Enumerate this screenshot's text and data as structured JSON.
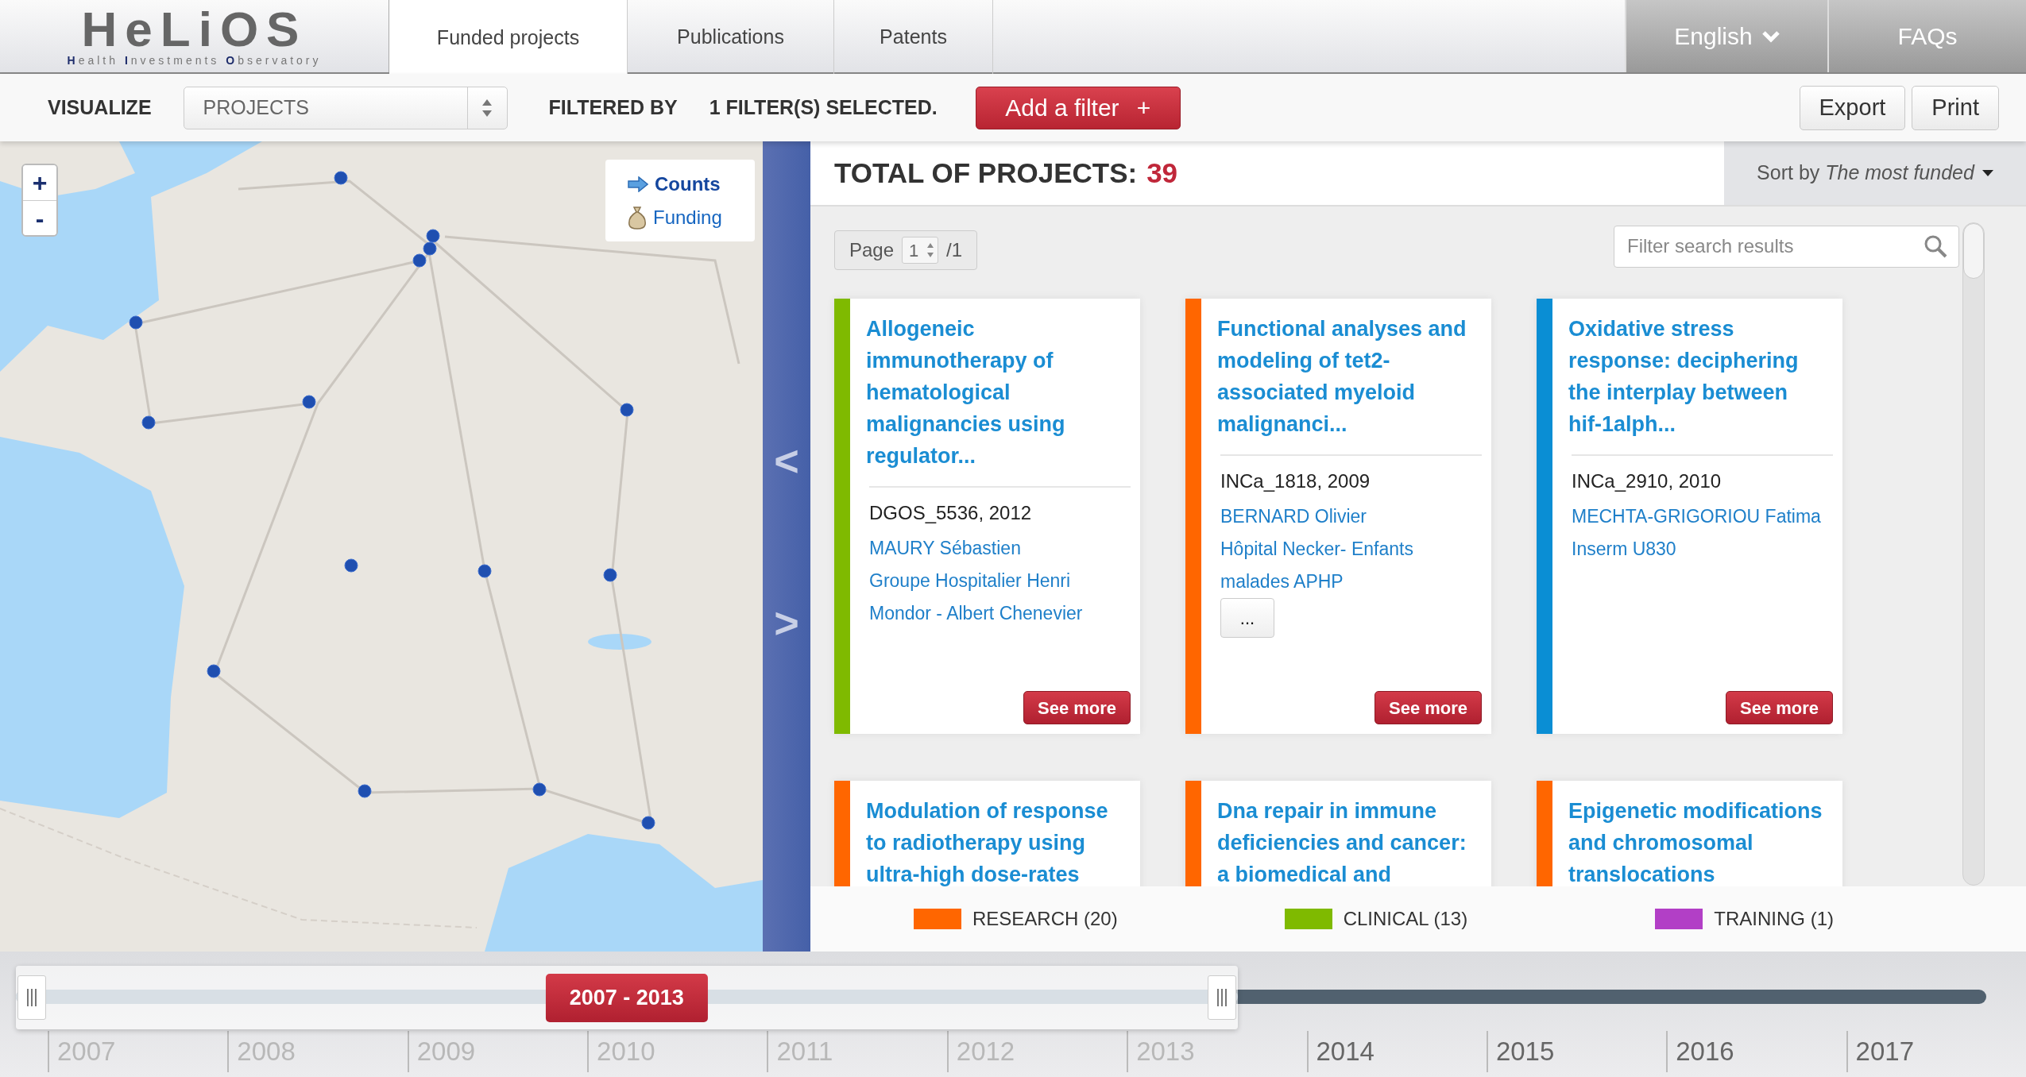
{
  "header": {
    "logo": {
      "title": "HeLiOS",
      "subtitle": "**H**ealth **I**nvestments **O**bservatory"
    },
    "tabs": [
      {
        "label": "Funded projects",
        "selected": true
      },
      {
        "label": "Publications",
        "selected": false
      },
      {
        "label": "Patents",
        "selected": false
      }
    ],
    "language": "English",
    "faqs": "FAQs"
  },
  "toolbar": {
    "visualize_label": "VISUALIZE",
    "visualize_value": "PROJECTS",
    "filtered_label": "FILTERED BY",
    "filter_status": "1 FILTER(S) SELECTED.",
    "add_filter": "Add a filter",
    "add_icon": "+",
    "buttons": [
      "Export",
      "Print"
    ]
  },
  "map": {
    "zoom_in": "+",
    "zoom_out": "-",
    "layers": [
      {
        "label": "Counts",
        "selected": true
      },
      {
        "label": "Funding",
        "selected": false
      }
    ],
    "collapse": "<",
    "expand": ">"
  },
  "results": {
    "total_label": "TOTAL OF PROJECTS:",
    "total": "39",
    "sort": "Sort by *The most funded*",
    "page_label": "Page",
    "page_value": "1",
    "page_total": "/1",
    "search_placeholder": "Filter search results",
    "cards": [
      {
        "color": "#7fba00",
        "title": "Allogeneic\nimmunotherapy of\nhematological\nmalignancies using\nregulator...",
        "code": "DGOS_5536, 2012",
        "people": [
          "MAURY Sébastien",
          "Groupe Hospitalier Henri\nMondor - Albert Chenevier"
        ],
        "button": "See more"
      },
      {
        "color": "#ff6600",
        "title": "Functional analyses and\nmodeling of tet2-\nassociated myeloid\nmalignanci...",
        "code": "INCa_1818, 2009",
        "people": [
          "BERNARD Olivier",
          "Hôpital Necker- Enfants\nmalades APHP"
        ],
        "more": "...",
        "button": "See more"
      },
      {
        "color": "#0a8ed4",
        "title": "Oxidative stress\nresponse: deciphering\nthe interplay between\nhif-1alph...",
        "code": "INCa_2910, 2010",
        "people": [
          "MECHTA-GRIGORIOU Fatima",
          "Inserm U830"
        ],
        "button": "See more"
      },
      {
        "color": "#ff6600",
        "title": "Modulation of response\nto radiotherapy using\nultra-high dose-rates"
      },
      {
        "color": "#ff6600",
        "title": "Dna repair in immune\ndeficiencies and cancer:\na biomedical and"
      },
      {
        "color": "#ff6600",
        "title": "Epigenetic modifications\nand chromosomal\ntranslocations"
      }
    ]
  },
  "legend": [
    {
      "label": "RESEARCH (20)",
      "color": "#ff6600"
    },
    {
      "label": "CLINICAL (13)",
      "color": "#7fba00"
    },
    {
      "label": "TRAINING (1)",
      "color": "#b23fc6"
    }
  ],
  "timeline": {
    "range": "2007 - 2013",
    "level": 0.62,
    "years": [
      {
        "label": "2007",
        "selected": true
      },
      {
        "label": "2008",
        "selected": true
      },
      {
        "label": "2009",
        "selected": true
      },
      {
        "label": "2010",
        "selected": true
      },
      {
        "label": "2011",
        "selected": true
      },
      {
        "label": "2012",
        "selected": true
      },
      {
        "label": "2013",
        "selected": true
      },
      {
        "label": "2014",
        "selected": false
      },
      {
        "label": "2015",
        "selected": false
      },
      {
        "label": "2016",
        "selected": false
      },
      {
        "label": "2017",
        "selected": false
      }
    ]
  }
}
